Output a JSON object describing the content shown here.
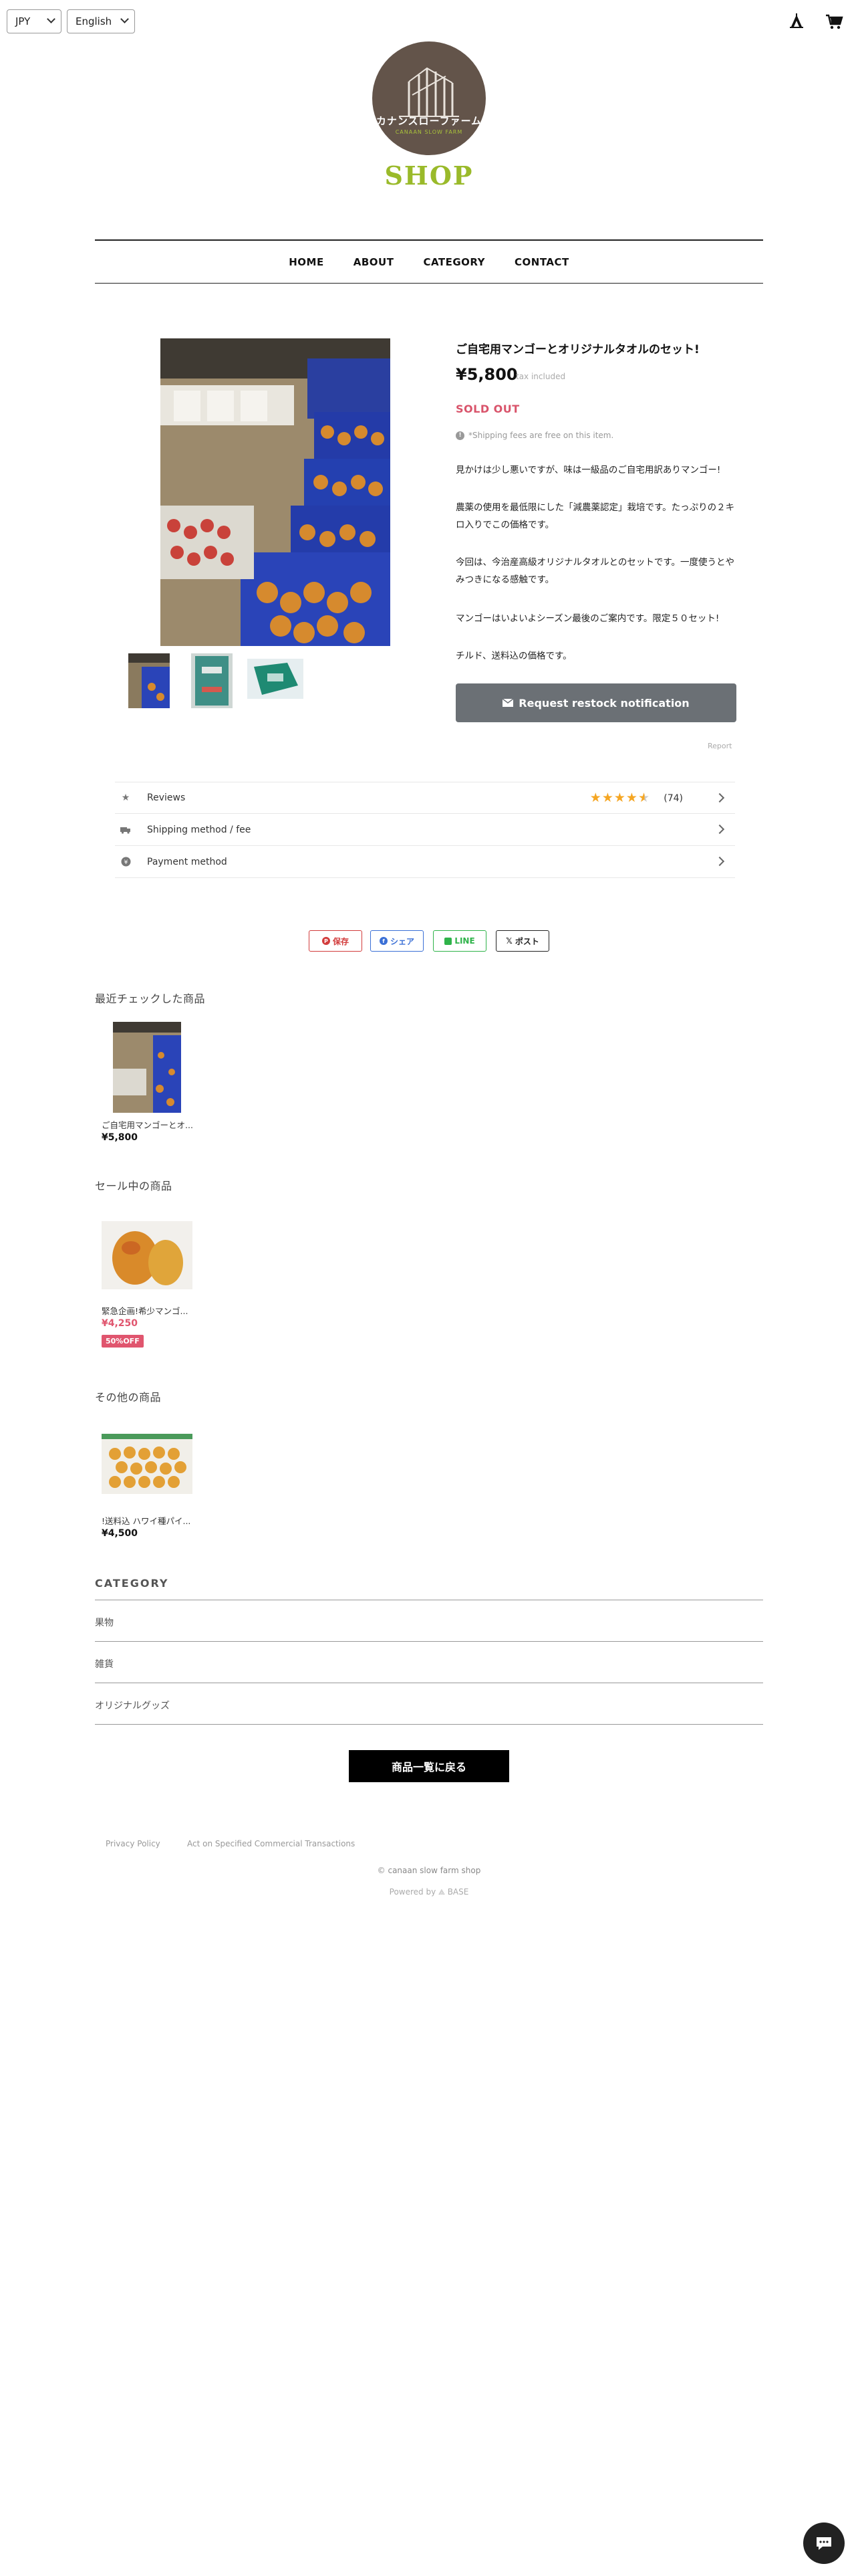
{
  "header": {
    "currency": "JPY",
    "language": "English"
  },
  "brand": {
    "logo_jp": "カナンスローファーム",
    "logo_en": "CANAAN SLOW FARM",
    "shop_label": "SHOP"
  },
  "nav": [
    "HOME",
    "ABOUT",
    "CATEGORY",
    "CONTACT"
  ],
  "product": {
    "title": "ご自宅用マンゴーとオリジナルタオルのセット!",
    "price": "¥5,800",
    "tax_note": "tax included",
    "status": "SOLD OUT",
    "shipping_note": "*Shipping fees are free on this item.",
    "description": [
      "見かけは少し悪いですが、味は一級品のご自宅用訳ありマンゴー!",
      "農薬の使用を最低限にした「減農薬認定」栽培です。たっぷりの２キロ入りでこの価格です。",
      "今回は、今治産高級オリジナルタオルとのセットです。一度使うとやみつきになる感触です。",
      "マンゴーはいよいよシーズン最後のご案内です。限定５０セット!",
      "チルド、送料込の価格です。"
    ],
    "restock_label": "Request restock notification",
    "report_label": "Report"
  },
  "accordion": {
    "reviews_label": "Reviews",
    "rating": 4.5,
    "review_count": "(74)",
    "shipping_label": "Shipping method / fee",
    "payment_label": "Payment method"
  },
  "share": {
    "save": "保存",
    "facebook": "シェア",
    "line": "LINE",
    "post": "ポスト"
  },
  "recent": {
    "title": "最近チェックした商品",
    "item_name": "ご自宅用マンゴーとオ...",
    "item_price": "¥5,800"
  },
  "sale": {
    "title": "セール中の商品",
    "item_name": "緊急企画!希少マンゴ...",
    "item_price": "¥4,250",
    "badge": "50%OFF"
  },
  "other": {
    "title": "その他の商品",
    "item_name": "!送料込 ハワイ種パイ...",
    "item_price": "¥4,500"
  },
  "category": {
    "title": "CATEGORY",
    "items": [
      "果物",
      "雑貨",
      "オリジナルグッズ"
    ]
  },
  "back_button": "商品一覧に戻る",
  "footer": {
    "privacy": "Privacy Policy",
    "act": "Act on Specified Commercial Transactions",
    "copyright": "© canaan slow farm shop",
    "powered": "Powered by",
    "powered_brand": "BASE"
  },
  "colors": {
    "sold_out": "#d9546b",
    "restock_button": "#6b7075",
    "star": "#f5a623",
    "logo_bg": "#63544a",
    "logo_accent": "#9aba2a"
  }
}
